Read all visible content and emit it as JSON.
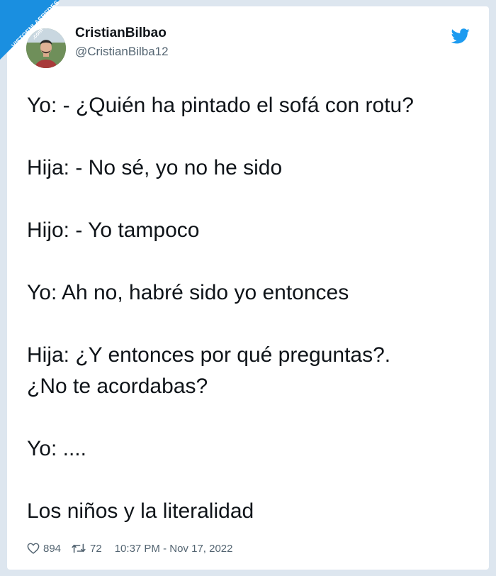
{
  "watermark": {
    "text": "VISTOENLASREDES",
    "suffix": ".com"
  },
  "tweet": {
    "author_name": "CristianBilbao",
    "author_handle": "@CristianBilba12",
    "lines": [
      "Yo: - ¿Quién ha pintado el sofá con rotu?",
      "",
      "Hija: - No sé, yo no he sido",
      "",
      "Hijo: - Yo tampoco",
      "",
      "Yo: Ah no, habré sido yo entonces",
      "",
      "Hija: ¿Y entonces por qué preguntas?.",
      "¿No te acordabas?",
      "",
      "Yo: ....",
      "",
      "Los niños y la literalidad"
    ],
    "likes": "894",
    "retweets": "72",
    "timestamp": "10:37 PM - Nov 17, 2022"
  },
  "colors": {
    "twitter_blue": "#1d9bf0",
    "watermark_blue": "#1a8fe0",
    "secondary_text": "#536471",
    "page_bg": "#dde6ef"
  },
  "icons": {
    "brand": "twitter-bird-icon",
    "like": "heart-icon",
    "retweet": "retweet-icon"
  }
}
